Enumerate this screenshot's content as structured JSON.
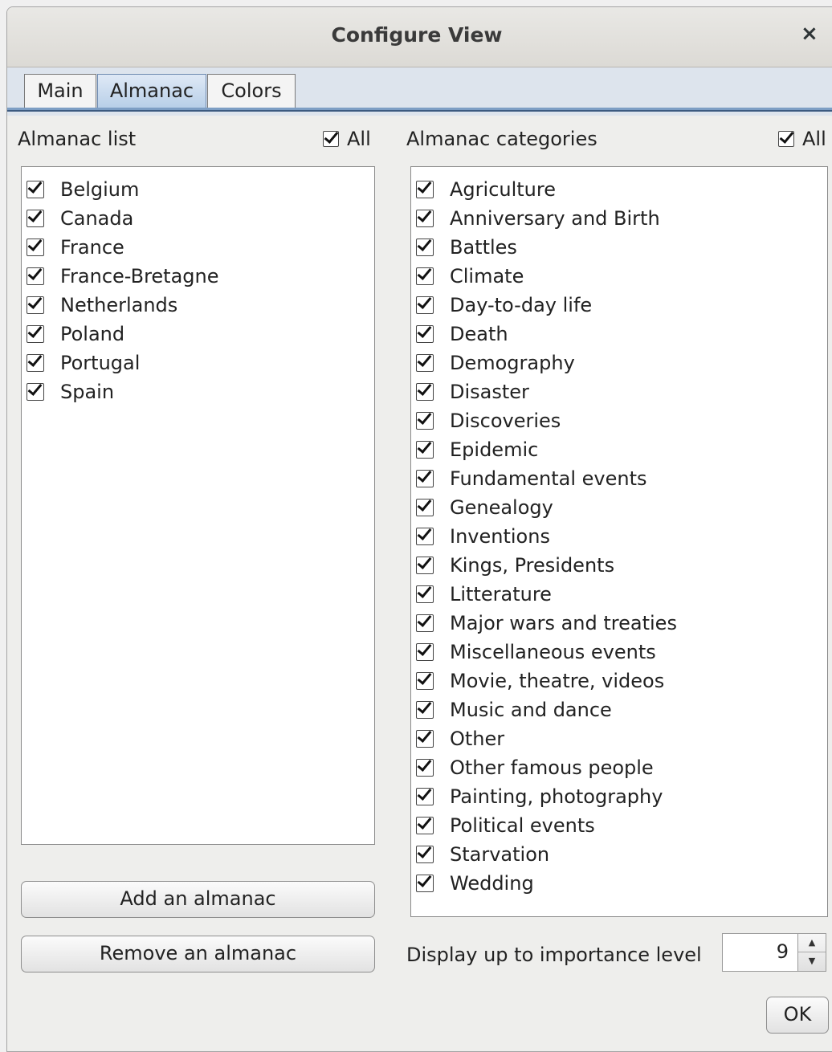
{
  "window": {
    "title": "Configure View",
    "close_glyph": "×"
  },
  "tabs": [
    {
      "label": "Main"
    },
    {
      "label": "Almanac"
    },
    {
      "label": "Colors"
    }
  ],
  "almanac_list": {
    "label": "Almanac list",
    "all_label": "All",
    "all_checked": true,
    "items": [
      {
        "label": "Belgium",
        "checked": true
      },
      {
        "label": "Canada",
        "checked": true
      },
      {
        "label": "France",
        "checked": true
      },
      {
        "label": "France-Bretagne",
        "checked": true
      },
      {
        "label": "Netherlands",
        "checked": true
      },
      {
        "label": "Poland",
        "checked": true
      },
      {
        "label": "Portugal",
        "checked": true
      },
      {
        "label": "Spain",
        "checked": true
      }
    ],
    "add_button": "Add an almanac",
    "remove_button": "Remove an almanac"
  },
  "almanac_categories": {
    "label": "Almanac categories",
    "all_label": "All",
    "all_checked": true,
    "items": [
      {
        "label": "Agriculture",
        "checked": true
      },
      {
        "label": "Anniversary and Birth",
        "checked": true
      },
      {
        "label": "Battles",
        "checked": true
      },
      {
        "label": "Climate",
        "checked": true
      },
      {
        "label": "Day-to-day life",
        "checked": true
      },
      {
        "label": "Death",
        "checked": true
      },
      {
        "label": "Demography",
        "checked": true
      },
      {
        "label": "Disaster",
        "checked": true
      },
      {
        "label": "Discoveries",
        "checked": true
      },
      {
        "label": "Epidemic",
        "checked": true
      },
      {
        "label": "Fundamental events",
        "checked": true
      },
      {
        "label": "Genealogy",
        "checked": true
      },
      {
        "label": "Inventions",
        "checked": true
      },
      {
        "label": "Kings, Presidents",
        "checked": true
      },
      {
        "label": "Litterature",
        "checked": true
      },
      {
        "label": "Major wars and treaties",
        "checked": true
      },
      {
        "label": "Miscellaneous events",
        "checked": true
      },
      {
        "label": "Movie, theatre, videos",
        "checked": true
      },
      {
        "label": "Music and dance",
        "checked": true
      },
      {
        "label": "Other",
        "checked": true
      },
      {
        "label": "Other famous people",
        "checked": true
      },
      {
        "label": "Painting, photography",
        "checked": true
      },
      {
        "label": "Political events",
        "checked": true
      },
      {
        "label": "Starvation",
        "checked": true
      },
      {
        "label": "Wedding",
        "checked": true
      }
    ]
  },
  "importance": {
    "label": "Display up to importance level",
    "value": "9"
  },
  "ok_button": "OK"
}
